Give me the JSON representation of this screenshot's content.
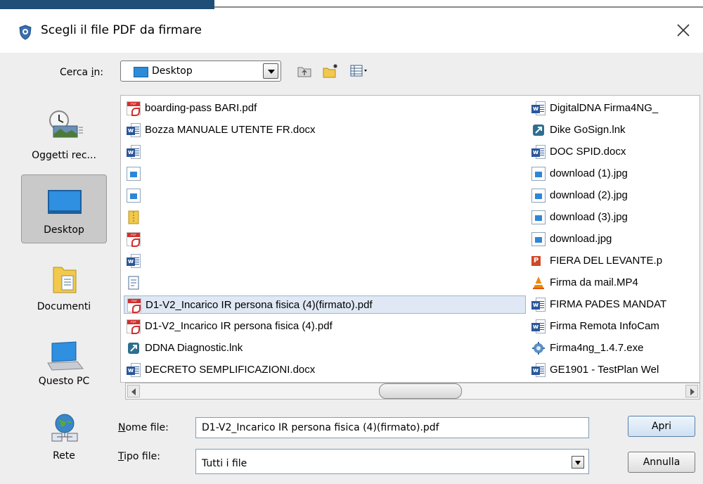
{
  "window": {
    "title": "Scegli il file PDF da firmare"
  },
  "toolbar": {
    "look_in_label_pre": "Cerca ",
    "look_in_label_mnemonic": "i",
    "look_in_label_post": "n:",
    "look_in_value": "Desktop"
  },
  "places": [
    {
      "label": "Oggetti rec..."
    },
    {
      "label": "Desktop"
    },
    {
      "label": "Documenti"
    },
    {
      "label": "Questo PC"
    },
    {
      "label": "Rete"
    }
  ],
  "files_col1": [
    {
      "name": "boarding-pass BARI.pdf",
      "icon": "pdf-icon"
    },
    {
      "name": "Bozza MANUALE UTENTE FR.docx",
      "icon": "word-icon"
    },
    {
      "name": "",
      "icon": "word-icon"
    },
    {
      "name": "",
      "icon": "image-icon"
    },
    {
      "name": "",
      "icon": "image-icon"
    },
    {
      "name": "",
      "icon": "zip-icon"
    },
    {
      "name": "",
      "icon": "pdf-icon"
    },
    {
      "name": "",
      "icon": "word-icon"
    },
    {
      "name": "",
      "icon": "text-icon"
    },
    {
      "name": "D1-V2_Incarico IR persona fisica (4)(firmato).pdf",
      "icon": "pdf-icon",
      "selected": true
    },
    {
      "name": "D1-V2_Incarico IR persona fisica (4).pdf",
      "icon": "pdf-icon"
    },
    {
      "name": "DDNA Diagnostic.lnk",
      "icon": "shortcut-icon"
    },
    {
      "name": "DECRETO SEMPLIFICAZIONI.docx",
      "icon": "word-icon"
    }
  ],
  "files_col2": [
    {
      "name": "DigitalDNA Firma4NG_",
      "icon": "word-icon"
    },
    {
      "name": "Dike GoSign.lnk",
      "icon": "shortcut-icon"
    },
    {
      "name": "DOC SPID.docx",
      "icon": "word-icon"
    },
    {
      "name": "download (1).jpg",
      "icon": "image-icon"
    },
    {
      "name": "download (2).jpg",
      "icon": "image-icon"
    },
    {
      "name": "download (3).jpg",
      "icon": "image-icon"
    },
    {
      "name": "download.jpg",
      "icon": "image-icon"
    },
    {
      "name": "FIERA DEL LEVANTE.p",
      "icon": "powerpoint-icon"
    },
    {
      "name": "Firma da mail.MP4",
      "icon": "vlc-icon"
    },
    {
      "name": "FIRMA PADES MANDAT",
      "icon": "word-icon"
    },
    {
      "name": "Firma Remota InfoCam",
      "icon": "word-icon"
    },
    {
      "name": "Firma4ng_1.4.7.exe",
      "icon": "setup-icon"
    },
    {
      "name": "GE1901 - TestPlan Wel",
      "icon": "word-icon"
    }
  ],
  "filename": {
    "label_mnemonic": "N",
    "label_rest": "ome file:",
    "value": "D1-V2_Incarico IR persona fisica (4)(firmato).pdf"
  },
  "filetype": {
    "label_mnemonic": "T",
    "label_rest": "ipo file:",
    "value": "Tutti i file"
  },
  "buttons": {
    "open": "Apri",
    "cancel": "Annulla"
  },
  "colors": {
    "accent": "#1f4e79",
    "selection": "#dfe8f4",
    "background": "#eeeeee"
  }
}
